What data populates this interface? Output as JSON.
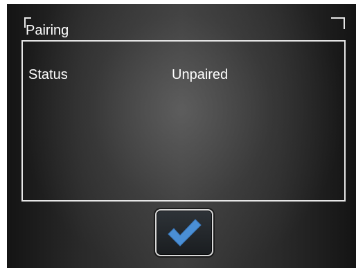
{
  "panel": {
    "title": "Pairing"
  },
  "rows": [
    {
      "label": "Status",
      "value": "Unpaired"
    }
  ],
  "actions": {
    "confirm_icon": "checkmark-icon",
    "accent_color": "#4a8fd6"
  }
}
